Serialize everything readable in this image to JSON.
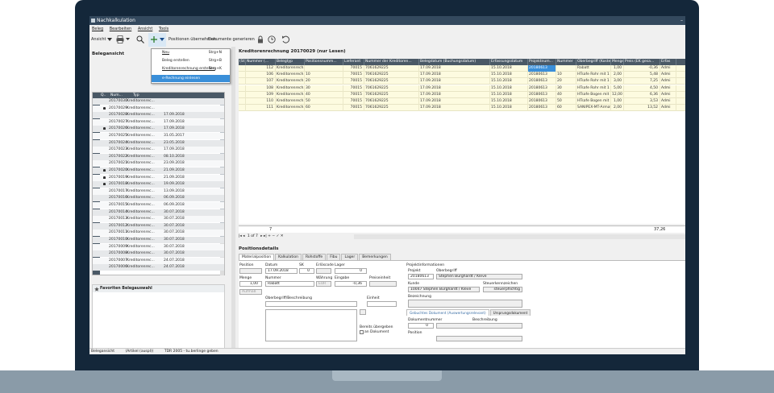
{
  "window": {
    "title": "Nachkalkulation",
    "minimize": "–"
  },
  "menu": [
    "Beleg",
    "Bearbeiten",
    "Ansicht",
    "Tools"
  ],
  "toolbar": {
    "view_label": "Ansicht",
    "take_positions": "Positionen übernehmen",
    "generate_documents": "Dokumente generieren"
  },
  "dropdown": {
    "items": [
      {
        "label": "Neu",
        "shortcut": "Strg+N"
      },
      {
        "label": "Beleg erstellen",
        "shortcut": "Strg+B"
      },
      {
        "label": "Kreditorenrechnung erstellen",
        "shortcut": "Strg+K"
      },
      {
        "label": "e-Rechnung einlesen",
        "shortcut": ""
      }
    ]
  },
  "left_panel": {
    "title": "Belegansicht",
    "columns": [
      "",
      "Q..",
      "Num...",
      "Typ"
    ],
    "rows": [
      {
        "num": "20170030",
        "typ": "Kreditorenrec...",
        "date": "",
        "lock": false
      },
      {
        "num": "20170029",
        "typ": "Kreditorenrec...",
        "date": "",
        "lock": true
      },
      {
        "num": "20170028",
        "typ": "Kreditorenrec...",
        "date": "17.09.2018",
        "lock": false
      },
      {
        "num": "20170027",
        "typ": "Kreditorenrec...",
        "date": "17.09.2018",
        "lock": false
      },
      {
        "num": "20170026",
        "typ": "Kreditorenrec...",
        "date": "17.09.2018",
        "lock": true
      },
      {
        "num": "20170025",
        "typ": "Kreditorenrec...",
        "date": "31.05.2017",
        "lock": false
      },
      {
        "num": "20170024",
        "typ": "Kreditorenrec...",
        "date": "23.05.2018",
        "lock": false
      },
      {
        "num": "20170023",
        "typ": "Kreditorenrec...",
        "date": "17.09.2018",
        "lock": false
      },
      {
        "num": "20170022",
        "typ": "Kreditorenrec...",
        "date": "08.10.2018",
        "lock": false
      },
      {
        "num": "20170021",
        "typ": "Kreditorenrec...",
        "date": "23.09.2018",
        "lock": false
      },
      {
        "num": "20170020",
        "typ": "Kreditorenrec...",
        "date": "21.09.2018",
        "lock": true
      },
      {
        "num": "20170019",
        "typ": "Kreditorenrec...",
        "date": "21.09.2018",
        "lock": true
      },
      {
        "num": "20170018",
        "typ": "Kreditorenrec...",
        "date": "19.09.2018",
        "lock": true
      },
      {
        "num": "20170017",
        "typ": "Kreditorenrec...",
        "date": "13.09.2018",
        "lock": false
      },
      {
        "num": "20170016",
        "typ": "Kreditorenrec...",
        "date": "06.09.2018",
        "lock": false
      },
      {
        "num": "20170015",
        "typ": "Kreditorenrec...",
        "date": "06.09.2018",
        "lock": false
      },
      {
        "num": "20170014",
        "typ": "Kreditorenrec...",
        "date": "30.07.2018",
        "lock": false
      },
      {
        "num": "20170013",
        "typ": "Kreditorenrec...",
        "date": "30.07.2018",
        "lock": false
      },
      {
        "num": "20170012",
        "typ": "Kreditorenrec...",
        "date": "30.07.2018",
        "lock": false
      },
      {
        "num": "20170011",
        "typ": "Kreditorenrec...",
        "date": "30.07.2018",
        "lock": false
      },
      {
        "num": "20170010",
        "typ": "Kreditorenrec...",
        "date": "30.07.2018",
        "lock": false
      },
      {
        "num": "20170009",
        "typ": "Kreditorenrec...",
        "date": "30.07.2018",
        "lock": false
      },
      {
        "num": "20170008",
        "typ": "Kreditorenrec...",
        "date": "30.07.2018",
        "lock": false
      },
      {
        "num": "20170007",
        "typ": "Kreditorenrec...",
        "date": "24.07.2018",
        "lock": false
      },
      {
        "num": "20170006",
        "typ": "Kreditorenrec...",
        "date": "24.07.2018",
        "lock": false
      }
    ],
    "favorites_title": "Favoriten Belegauswahl"
  },
  "main": {
    "title": "Kreditorenrechnung 20170029 (nur Lesen)",
    "columns": [
      "(St)",
      "Nummer (...",
      "Belegtyp",
      "Positionsnumm...",
      "Lieferant",
      "Nummer der Kreditoren...",
      "Belegdatum (Buchungsdatum)",
      "Erfassungsdatum",
      "Projektnum...",
      "Nummer",
      "Oberbegriff (Kosten...",
      "Menge",
      "Preis (EK gesa...",
      "Erfas"
    ],
    "rows": [
      {
        "nr": "112",
        "typ": "Kreditorenrech...",
        "pos": "",
        "lief": "70015",
        "kred": "7061629225",
        "beleg": "17.09.2018",
        "erf": "15.10.2018",
        "proj": "20180613",
        "num": "",
        "ober": "Rabatt",
        "menge": "1,00",
        "preis": "-0,36",
        "erfas": "Admi"
      },
      {
        "nr": "106",
        "typ": "Kreditorenrech...",
        "pos": "10",
        "lief": "70015",
        "kred": "7061629225",
        "beleg": "17.09.2018",
        "erf": "15.10.2018",
        "proj": "20180613",
        "num": "10",
        "ober": "HTsafe Rohr mit 1 ...",
        "menge": "2,00",
        "preis": "5,48",
        "erfas": "Admi"
      },
      {
        "nr": "107",
        "typ": "Kreditorenrech...",
        "pos": "20",
        "lief": "70015",
        "kred": "7061629225",
        "beleg": "17.09.2018",
        "erf": "15.10.2018",
        "proj": "20180613",
        "num": "20",
        "ober": "HTsafe Rohr mit 1 ...",
        "menge": "3,00",
        "preis": "7,25",
        "erfas": "Admi"
      },
      {
        "nr": "108",
        "typ": "Kreditorenrech...",
        "pos": "30",
        "lief": "70015",
        "kred": "7061629225",
        "beleg": "17.09.2018",
        "erf": "15.10.2018",
        "proj": "20180613",
        "num": "30",
        "ober": "HTsafe Rohr mit 1 ...",
        "menge": "5,00",
        "preis": "4,50",
        "erfas": "Admi"
      },
      {
        "nr": "109",
        "typ": "Kreditorenrech...",
        "pos": "40",
        "lief": "70015",
        "kred": "7061629225",
        "beleg": "17.09.2018",
        "erf": "15.10.2018",
        "proj": "20180613",
        "num": "40",
        "ober": "HTsafe Bogen mit Di...",
        "menge": "12,00",
        "preis": "6,36",
        "erfas": "Admi"
      },
      {
        "nr": "110",
        "typ": "Kreditorenrech...",
        "pos": "50",
        "lief": "70015",
        "kred": "7061629225",
        "beleg": "17.09.2018",
        "erf": "15.10.2018",
        "proj": "20180613",
        "num": "50",
        "ober": "HTsafe Bogen mit Di...",
        "menge": "1,00",
        "preis": "3,53",
        "erfas": "Admi"
      },
      {
        "nr": "111",
        "typ": "Kreditorenrech...",
        "pos": "60",
        "lief": "70015",
        "kred": "7061629225",
        "beleg": "17.09.2018",
        "erf": "15.10.2018",
        "proj": "20180613",
        "num": "60",
        "ober": "SANIPEX-MT-Armat...",
        "menge": "2,00",
        "preis": "13,52",
        "erfas": "Admi"
      }
    ],
    "footer_count": "7",
    "footer_sum": "37,26",
    "nav": "1 of 7"
  },
  "details": {
    "title": "Positionsdetails",
    "tabs": [
      "Materialposition",
      "Kalkulation",
      "Rohstoffe",
      "Fibu",
      "Lager",
      "Bemerkungen"
    ],
    "labels": {
      "position": "Position",
      "datum": "Datum",
      "sk": "SK",
      "erloscode": "Erlöscode",
      "lager": "Lager",
      "menge": "Menge",
      "nummer": "Nummer",
      "waehrung": "Währung",
      "eingabe": "Eingabe",
      "preiseinheit": "Preiseinheit",
      "aufmass": "Aufmaß",
      "oberbegriff": "Oberbegriff/Beschreibung",
      "einheit": "Einheit",
      "bereits": "Bereits übergeben",
      "an_dokument": "an Dokument",
      "projinfo": "Projektinformationen",
      "projekt": "Projekt",
      "oberbegriff2": "Oberbegriff",
      "kunde": "Kunde",
      "steuer": "Steuerkennzeichen",
      "bezeichnung": "Bezeichnung",
      "dokumentnummer": "Dokumentnummer",
      "beschreibung": "Beschreibung",
      "position2": "Position"
    },
    "values": {
      "datum": "17.09.2018",
      "sk": "0",
      "lager": "0",
      "menge": "1,00",
      "nummer": "Rabatt",
      "waehrung": "EUR",
      "eingabe": "-0,36",
      "projekt": "20180613",
      "projekt_name": "Stephen Burghardt / Kleve",
      "kunde": "10047 Stephen Burghardt / Kleve",
      "steuer": "steuerpflichtig",
      "doknr": "0"
    },
    "subtabs": [
      "Gebuchtes Dokument (Auswertungsrelevant)",
      "Ursprungsdokument"
    ]
  },
  "statusbar": [
    "Belegansicht",
    "(Artikel (auspl))",
    "TDR 2005 - tu.berlinge geben"
  ]
}
